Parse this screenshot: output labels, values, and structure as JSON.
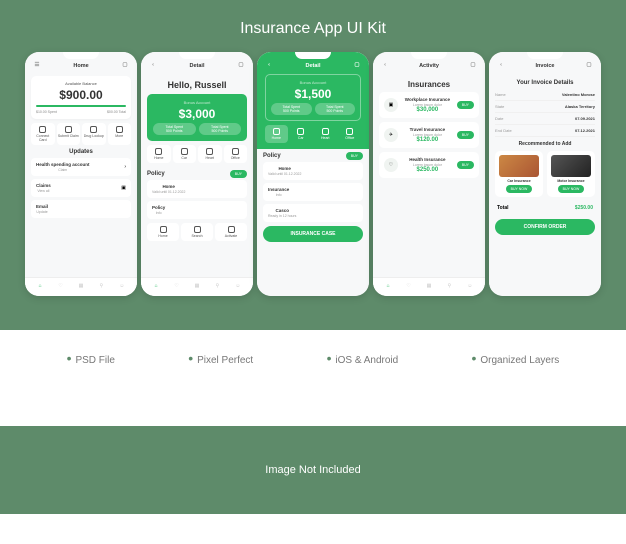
{
  "page_title": "Insurance App UI Kit",
  "features": [
    "PSD File",
    "Pixel Perfect",
    "iOS & Android",
    "Organized Layers"
  ],
  "footer_note": "Image Not Included",
  "accent": "#2bb862",
  "screens": {
    "home": {
      "title": "Home",
      "balance_label": "Available Balance",
      "balance": "$900.00",
      "stats": {
        "spent_label": "Total Spent",
        "spent": "$10.00 Spent",
        "bill_label": "Bill Total",
        "bill": "$00.00 Total"
      },
      "actions": [
        {
          "label": "Connect Card"
        },
        {
          "label": "Submit Claim"
        },
        {
          "label": "Drug Lookup"
        },
        {
          "label": "More"
        }
      ],
      "updates_title": "Updates",
      "updates": [
        {
          "title": "Health spending account",
          "sub": "Claim "
        },
        {
          "title": "Claims",
          "sub": "View all"
        },
        {
          "title": "Email",
          "sub": "Update"
        }
      ]
    },
    "detail1": {
      "title": "Detail",
      "greeting": "Hello, Russell",
      "bonus_label": "Bonus Account",
      "bonus": "$3,000",
      "pills": [
        {
          "t": "Total Spent",
          "v": "500 Points"
        },
        {
          "t": "Total Spent",
          "v": "500 Points"
        }
      ],
      "chips": [
        "Home",
        "Car",
        "Heart",
        "Office"
      ],
      "policy_title": "Policy",
      "buy": "BUY",
      "policies": [
        {
          "name": "Home",
          "sub": "Valid until 01.12.2022"
        },
        {
          "name": "Policy",
          "sub": "Info"
        }
      ],
      "bottom_actions": [
        "Home",
        "Search",
        "Activate"
      ]
    },
    "detail2": {
      "title": "Detail",
      "bonus_label": "Bonus Account",
      "bonus": "$1,500",
      "pills": [
        {
          "t": "Total Spent",
          "v": "500 Points"
        },
        {
          "t": "Total Spent",
          "v": "500 Points"
        }
      ],
      "chips": [
        "Home",
        "Car",
        "Heart",
        "Office"
      ],
      "policy_title": "Policy",
      "buy": "BUY",
      "policies": [
        {
          "name": "Home",
          "sub": "Valid until 01.12.2022"
        },
        {
          "name": "Insurance",
          "sub": "Info"
        },
        {
          "name": "Casco",
          "sub": "Ready in 12 hours"
        }
      ],
      "cta": "INSURANCE CASE"
    },
    "activity": {
      "title": "Activity",
      "section": "Insurances",
      "buy": "BUY",
      "items": [
        {
          "name": "Workplace Insurance",
          "sub": "Lorem ipsum dolor",
          "price": "$30,000"
        },
        {
          "name": "Travel Insurance",
          "sub": "Lorem ipsum dolor",
          "price": "$120.00"
        },
        {
          "name": "Health Insurance",
          "sub": "Lorem ipsum dolor",
          "price": "$250.00"
        }
      ]
    },
    "invoice": {
      "title": "Invoice",
      "section": "Your Invoice Details",
      "details": [
        {
          "k": "Name",
          "v": "Valentino Morose"
        },
        {
          "k": "State",
          "v": "Alaska Territory"
        },
        {
          "k": "Date",
          "v": "07.09.2021"
        },
        {
          "k": "End Date",
          "v": "07.12.2021"
        }
      ],
      "rec_title": "Recommended to Add",
      "recs": [
        {
          "name": "Car Insurance",
          "btn": "BUY NOW"
        },
        {
          "name": "Motor Insurance",
          "btn": "BUY NOW"
        }
      ],
      "total_label": "Total",
      "total": "$250.00",
      "cta": "CONFIRM ORDER"
    }
  }
}
